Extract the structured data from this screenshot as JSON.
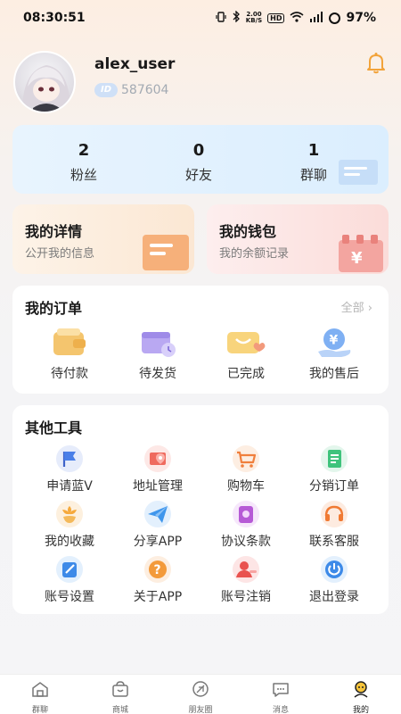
{
  "status_bar": {
    "time": "08:30:51",
    "net_speed_top": "2.00",
    "net_speed_unit": "KB/S",
    "hd": "HD",
    "battery": "97%"
  },
  "profile": {
    "username": "alex_user",
    "id_badge": "ID",
    "user_id": "587604"
  },
  "stats": [
    {
      "count": "2",
      "label": "粉丝"
    },
    {
      "count": "0",
      "label": "好友"
    },
    {
      "count": "1",
      "label": "群聊"
    }
  ],
  "feature_cards": {
    "details": {
      "title": "我的详情",
      "subtitle": "公开我的信息"
    },
    "wallet": {
      "title": "我的钱包",
      "subtitle": "我的余额记录"
    }
  },
  "orders": {
    "title": "我的订单",
    "more": "全部",
    "items": [
      {
        "label": "待付款",
        "icon": "wallet-icon"
      },
      {
        "label": "待发货",
        "icon": "calendar-clock-icon"
      },
      {
        "label": "已完成",
        "icon": "smile-card-icon"
      },
      {
        "label": "我的售后",
        "icon": "yen-hand-icon"
      }
    ]
  },
  "tools": {
    "title": "其他工具",
    "items": [
      {
        "label": "申请蓝V",
        "icon": "flag-icon"
      },
      {
        "label": "地址管理",
        "icon": "map-pin-icon"
      },
      {
        "label": "购物车",
        "icon": "cart-icon"
      },
      {
        "label": "分销订单",
        "icon": "document-list-icon"
      },
      {
        "label": "我的收藏",
        "icon": "flower-icon"
      },
      {
        "label": "分享APP",
        "icon": "paper-plane-icon"
      },
      {
        "label": "协议条款",
        "icon": "agreement-icon"
      },
      {
        "label": "联系客服",
        "icon": "headset-icon"
      },
      {
        "label": "账号设置",
        "icon": "edit-icon"
      },
      {
        "label": "关于APP",
        "icon": "question-icon"
      },
      {
        "label": "账号注销",
        "icon": "user-remove-icon"
      },
      {
        "label": "退出登录",
        "icon": "power-icon"
      }
    ]
  },
  "tabbar": [
    {
      "label": "群聊",
      "icon": "home-icon"
    },
    {
      "label": "商城",
      "icon": "shop-bag-icon"
    },
    {
      "label": "朋友圈",
      "icon": "feather-icon"
    },
    {
      "label": "消息",
      "icon": "chat-icon"
    },
    {
      "label": "我的",
      "icon": "profile-icon",
      "active": true
    }
  ],
  "colors": {
    "accent_orange": "#f2a33a",
    "stats_bg": "#e3f1fe",
    "blue": "#4a7fe8"
  }
}
